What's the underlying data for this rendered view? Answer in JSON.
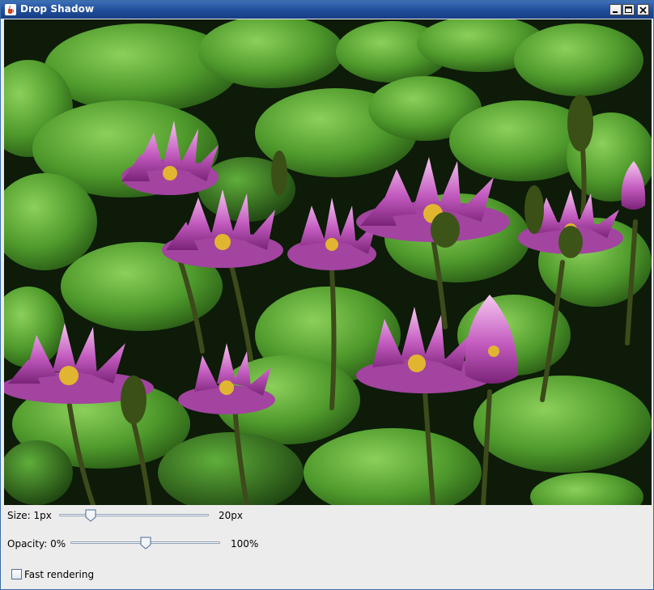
{
  "window": {
    "title": "Drop Shadow",
    "icons": [
      "java-coffee-icon",
      "minimize-icon",
      "maximize-icon",
      "close-icon"
    ]
  },
  "image": {
    "subject": "photo"
  },
  "controls": {
    "size": {
      "label": "Size: 1px",
      "max_label": "20px",
      "value_fraction": 0.21
    },
    "opacity": {
      "label": "Opacity: 0%",
      "max_label": "100%",
      "value_fraction": 0.5
    },
    "fast_rendering": {
      "label": "Fast rendering",
      "checked": false
    }
  },
  "colors": {
    "titlebar": "#1f4c99",
    "panel_background": "#ececec",
    "accent": "#8e9fb3"
  }
}
